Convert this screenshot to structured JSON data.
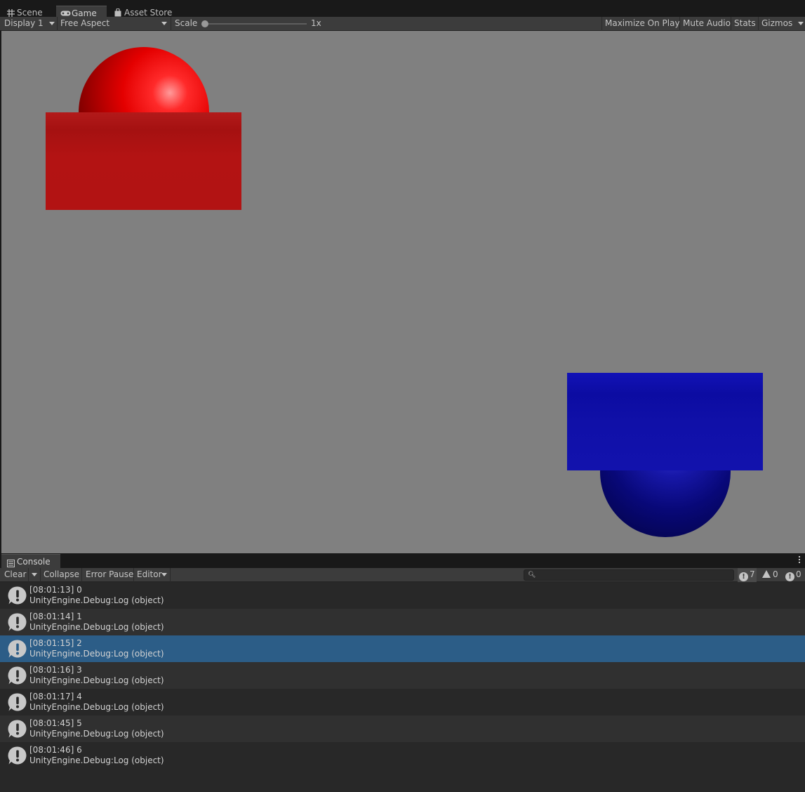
{
  "tabs": [
    {
      "label": "Scene",
      "icon": "grid-icon"
    },
    {
      "label": "Game",
      "icon": "gamepad-icon",
      "active": true
    },
    {
      "label": "Asset Store",
      "icon": "shopping-bag-icon"
    }
  ],
  "game_toolbar": {
    "display": "Display 1",
    "aspect": "Free Aspect",
    "scale_label": "Scale",
    "scale_value": "1x",
    "maximize_on_play": "Maximize On Play",
    "mute_audio": "Mute Audio",
    "stats": "Stats",
    "gizmos": "Gizmos"
  },
  "scene_objects": {
    "red_color": "#cc0000",
    "blue_color": "#0a0aa8",
    "background_color": "#808080"
  },
  "console": {
    "tab_label": "Console",
    "clear": "Clear",
    "collapse": "Collapse",
    "error_pause": "Error Pause",
    "editor": "Editor",
    "search_placeholder": "",
    "log_count": "7",
    "warning_count": "0",
    "error_count": "0",
    "selected_color": "#2c5d87",
    "entries": [
      {
        "line1": "[08:01:13] 0",
        "line2": "UnityEngine.Debug:Log (object)"
      },
      {
        "line1": "[08:01:14] 1",
        "line2": "UnityEngine.Debug:Log (object)"
      },
      {
        "line1": "[08:01:15] 2",
        "line2": "UnityEngine.Debug:Log (object)"
      },
      {
        "line1": "[08:01:16] 3",
        "line2": "UnityEngine.Debug:Log (object)"
      },
      {
        "line1": "[08:01:17] 4",
        "line2": "UnityEngine.Debug:Log (object)"
      },
      {
        "line1": "[08:01:45] 5",
        "line2": "UnityEngine.Debug:Log (object)"
      },
      {
        "line1": "[08:01:46] 6",
        "line2": "UnityEngine.Debug:Log (object)"
      }
    ]
  }
}
